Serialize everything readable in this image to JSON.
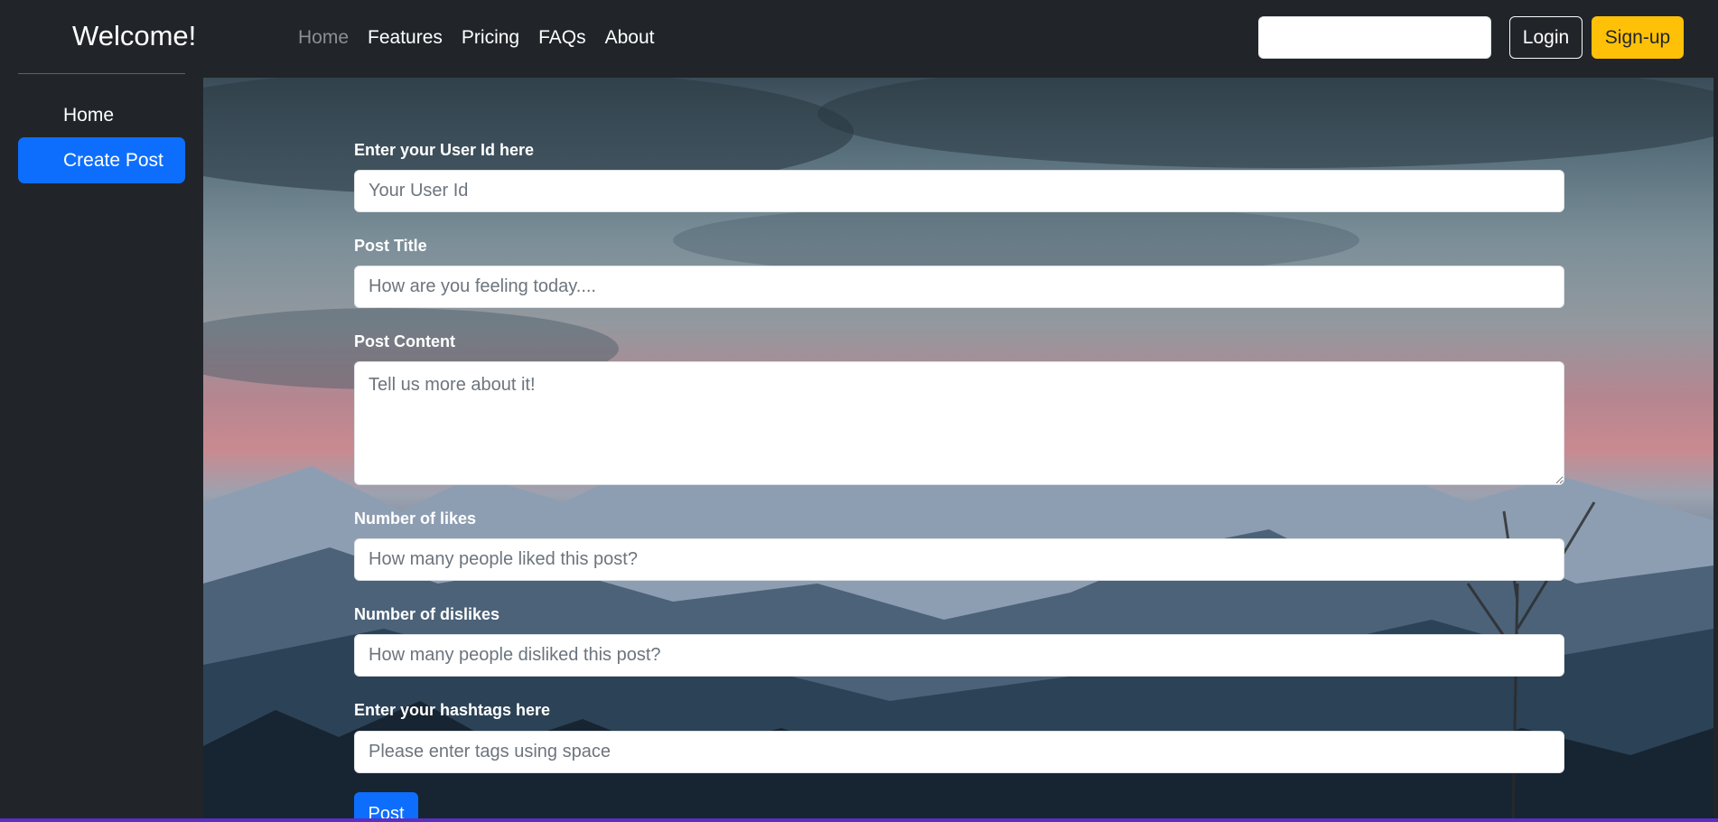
{
  "header": {
    "brand": "Welcome!",
    "nav": [
      "Home",
      "Features",
      "Pricing",
      "FAQs",
      "About"
    ],
    "search": {
      "placeholder": "",
      "value": ""
    },
    "login_label": "Login",
    "signup_label": "Sign-up"
  },
  "sidebar": {
    "items": [
      {
        "label": "Home",
        "active": false
      },
      {
        "label": "Create Post",
        "active": true
      }
    ]
  },
  "form": {
    "fields": [
      {
        "label": "Enter your User Id here",
        "placeholder": "Your User Id"
      },
      {
        "label": "Post Title",
        "placeholder": "How are you feeling today...."
      },
      {
        "label": "Post Content",
        "placeholder": "Tell us more about it!"
      },
      {
        "label": "Number of likes",
        "placeholder": "How many people liked this post?"
      },
      {
        "label": "Number of dislikes",
        "placeholder": "How many people disliked this post?"
      },
      {
        "label": "Enter your hashtags here",
        "placeholder": "Please enter tags using space"
      }
    ],
    "submit_label": "Post"
  },
  "colors": {
    "background": "#212529",
    "primary": "#0d6efd",
    "warning": "#ffc107"
  }
}
